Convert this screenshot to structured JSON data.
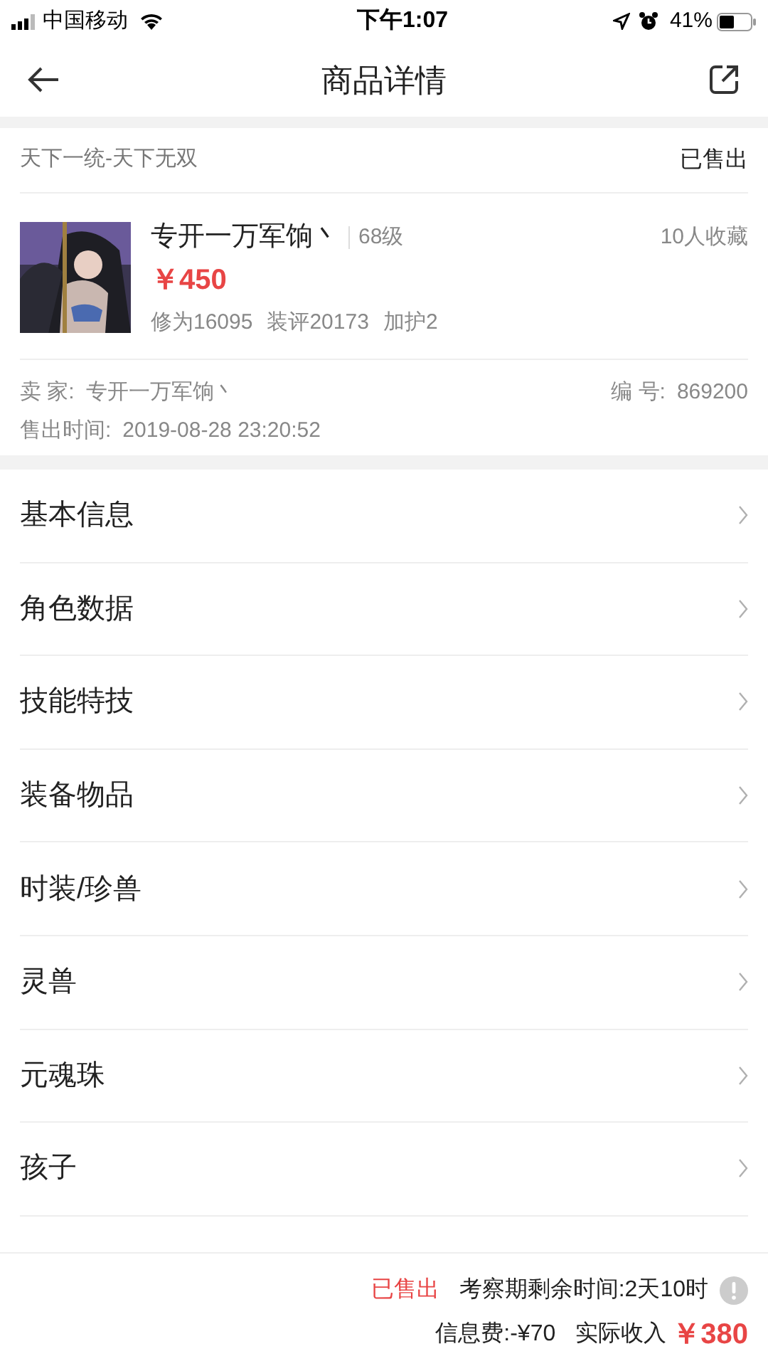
{
  "status_bar": {
    "carrier": "中国移动",
    "time": "下午1:07",
    "battery": "41%"
  },
  "nav": {
    "title": "商品详情"
  },
  "listing": {
    "server": "天下一统-天下无双",
    "status": "已售出",
    "name": "专开一万军饷丶",
    "level": "68级",
    "favorites": "10人收藏",
    "price": "￥450",
    "stats": [
      "修为16095",
      "装评20173",
      "加护2"
    ],
    "seller_label": "卖 家:",
    "seller": "专开一万军饷丶",
    "id_label": "编 号:",
    "id": "869200",
    "sold_time_label": "售出时间:",
    "sold_time": "2019-08-28 23:20:52"
  },
  "sections": [
    "基本信息",
    "角色数据",
    "技能特技",
    "装备物品",
    "时装/珍兽",
    "灵兽",
    "元魂珠",
    "孩子"
  ],
  "footer": {
    "status": "已售出",
    "countdown": "考察期剩余时间:2天10时",
    "fee": "信息费:-¥70",
    "income_label": "实际收入",
    "income": "￥380"
  }
}
